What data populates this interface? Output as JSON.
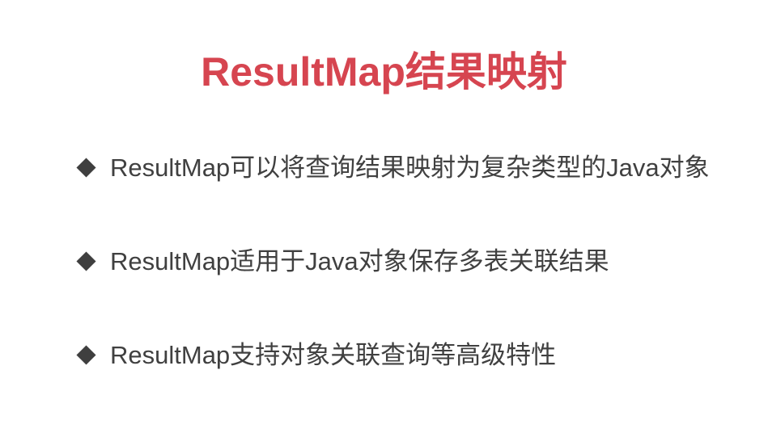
{
  "slide": {
    "title": "ResultMap结果映射",
    "bullets": [
      {
        "icon": "diamond-bullet-icon",
        "text": "ResultMap可以将查询结果映射为复杂类型的Java对象"
      },
      {
        "icon": "diamond-bullet-icon",
        "text": "ResultMap适用于Java对象保存多表关联结果"
      },
      {
        "icon": "diamond-bullet-icon",
        "text": "ResultMap支持对象关联查询等高级特性"
      }
    ]
  },
  "colors": {
    "title": "#d64550",
    "bullet_text": "#404040",
    "bullet_marker": "#3f3f3f",
    "background": "#ffffff"
  }
}
